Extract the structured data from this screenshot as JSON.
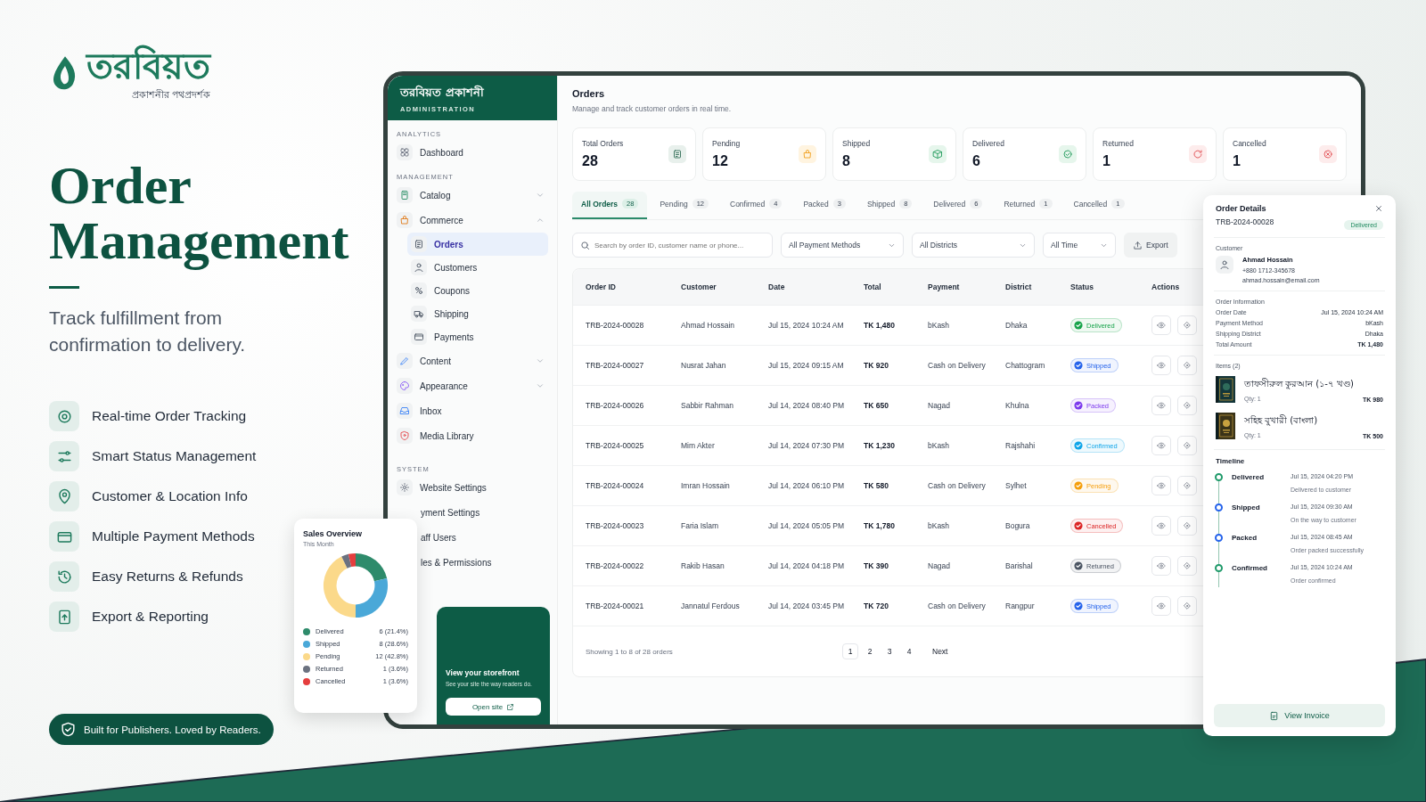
{
  "brand": {
    "name": "তরবিয়ত",
    "tagline": "প্রকাশনীর পথপ্রদর্শক"
  },
  "hero": {
    "title": "Order Management",
    "subtitle": "Track fulfillment from confirmation to delivery."
  },
  "features": [
    "Real-time Order Tracking",
    "Smart Status Management",
    "Customer & Location Info",
    "Multiple Payment Methods",
    "Easy Returns & Refunds",
    "Export & Reporting"
  ],
  "badge": "Built for Publishers. Loved by Readers.",
  "sidebar": {
    "title": "তরবিয়ত প্রকাশনী",
    "subtitle": "ADMINISTRATION",
    "sections": [
      {
        "label": "ANALYTICS",
        "items": [
          {
            "label": "Dashboard",
            "selected": false
          }
        ]
      },
      {
        "label": "MANAGEMENT",
        "items": [
          {
            "label": "Catalog",
            "selected": false,
            "expanded": false
          },
          {
            "label": "Commerce",
            "selected": false,
            "expanded": true,
            "children": [
              {
                "label": "Orders",
                "selected": true
              },
              {
                "label": "Customers",
                "selected": false
              },
              {
                "label": "Coupons",
                "selected": false
              },
              {
                "label": "Shipping",
                "selected": false
              },
              {
                "label": "Payments",
                "selected": false
              }
            ]
          },
          {
            "label": "Content",
            "selected": false,
            "expanded": false
          },
          {
            "label": "Appearance",
            "selected": false,
            "expanded": false
          },
          {
            "label": "Inbox",
            "selected": false
          },
          {
            "label": "Media Library",
            "selected": false
          }
        ]
      },
      {
        "label": "SYSTEM",
        "items": [
          {
            "label": "Website Settings",
            "selected": false
          },
          {
            "label": "yment Settings",
            "selected": false
          },
          {
            "label": "aff Users",
            "selected": false
          },
          {
            "label": "les & Permissions",
            "selected": false
          }
        ]
      }
    ]
  },
  "storefront": {
    "title": "View your storefront",
    "text": "See your site the way readers do.",
    "button": "Open site"
  },
  "sales_overview": {
    "title": "Sales Overview",
    "subtitle": "This Month",
    "chart_data": {
      "type": "donut",
      "categories": [
        "Delivered",
        "Shipped",
        "Pending",
        "Returned",
        "Cancelled"
      ],
      "values": [
        21.4,
        28.6,
        42.8,
        3.6,
        3.6
      ],
      "legend": "bottom"
    },
    "legend": [
      {
        "value": "6 (21.4%)",
        "color": "#2e8b6b"
      },
      {
        "value": "8 (28.6%)",
        "color": "#4aa8d8"
      },
      {
        "value": "12 (42.8%)",
        "color": "#fbd98a"
      },
      {
        "value": "1 (3.6%)",
        "color": "#6b7280"
      },
      {
        "value": "1 (3.6%)",
        "color": "#e53e3e"
      }
    ]
  },
  "page_header": {
    "title": "Orders",
    "subtitle": "Manage and track customer orders in real time."
  },
  "stats": [
    {
      "label": "Total Orders",
      "value": "28"
    },
    {
      "label": "Pending",
      "value": "12"
    },
    {
      "label": "Shipped",
      "value": "8"
    },
    {
      "label": "Delivered",
      "value": "6"
    },
    {
      "label": "Returned",
      "value": "1"
    },
    {
      "label": "Cancelled",
      "value": "1"
    }
  ],
  "tabs": [
    {
      "label": "All Orders",
      "count": "28",
      "selected": true
    },
    {
      "label": "Pending",
      "count": "12",
      "selected": false
    },
    {
      "label": "Confirmed",
      "count": "4",
      "selected": false
    },
    {
      "label": "Packed",
      "count": "3",
      "selected": false
    },
    {
      "label": "Shipped",
      "count": "8",
      "selected": false
    },
    {
      "label": "Delivered",
      "count": "6",
      "selected": false
    },
    {
      "label": "Returned",
      "count": "1",
      "selected": false
    },
    {
      "label": "Cancelled",
      "count": "1",
      "selected": false
    }
  ],
  "filters": {
    "search_placeholder": "Search by order ID, customer name or phone...",
    "dropdowns": [
      "All Payment Methods",
      "All Districts",
      "All Time"
    ],
    "export": "Export"
  },
  "table": {
    "columns": [
      "Order ID",
      "Customer",
      "Date",
      "Total",
      "Payment",
      "District",
      "Status",
      "Actions"
    ],
    "rows": [
      {
        "id": "TRB-2024-00028",
        "customer": "Ahmad Hossain",
        "date": "Jul 15, 2024 10:24 AM",
        "total": "TK 1,480",
        "payment": "bKash",
        "district": "Dhaka",
        "status": "Delivered",
        "color": "#16a34a"
      },
      {
        "id": "TRB-2024-00027",
        "customer": "Nusrat Jahan",
        "date": "Jul 15, 2024 09:15 AM",
        "total": "TK 920",
        "payment": "Cash on Delivery",
        "district": "Chattogram",
        "status": "Shipped",
        "color": "#2563eb"
      },
      {
        "id": "TRB-2024-00026",
        "customer": "Sabbir Rahman",
        "date": "Jul 14, 2024 08:40 PM",
        "total": "TK 650",
        "payment": "Nagad",
        "district": "Khulna",
        "status": "Packed",
        "color": "#7c3aed"
      },
      {
        "id": "TRB-2024-00025",
        "customer": "Mim Akter",
        "date": "Jul 14, 2024 07:30 PM",
        "total": "TK 1,230",
        "payment": "bKash",
        "district": "Rajshahi",
        "status": "Confirmed",
        "color": "#0ea5e9"
      },
      {
        "id": "TRB-2024-00024",
        "customer": "Imran Hossain",
        "date": "Jul 14, 2024 06:10 PM",
        "total": "TK 580",
        "payment": "Cash on Delivery",
        "district": "Sylhet",
        "status": "Pending",
        "color": "#f59e0b"
      },
      {
        "id": "TRB-2024-00023",
        "customer": "Faria Islam",
        "date": "Jul 14, 2024 05:05 PM",
        "total": "TK 1,780",
        "payment": "bKash",
        "district": "Bogura",
        "status": "Cancelled",
        "color": "#dc2626"
      },
      {
        "id": "TRB-2024-00022",
        "customer": "Rakib Hasan",
        "date": "Jul 14, 2024 04:18 PM",
        "total": "TK 390",
        "payment": "Nagad",
        "district": "Barishal",
        "status": "Returned",
        "color": "#4b5563"
      },
      {
        "id": "TRB-2024-00021",
        "customer": "Jannatul Ferdous",
        "date": "Jul 14, 2024 03:45 PM",
        "total": "TK 720",
        "payment": "Cash on Delivery",
        "district": "Rangpur",
        "status": "Shipped",
        "color": "#2563eb"
      }
    ]
  },
  "pagination": {
    "summary": "Showing 1 to 8 of 28 orders",
    "pages": [
      {
        "label": "1",
        "selected": true
      },
      {
        "label": "2",
        "selected": false
      },
      {
        "label": "3",
        "selected": false
      },
      {
        "label": "4",
        "selected": false
      }
    ],
    "next": "Next"
  },
  "order_details": {
    "title": "Order Details",
    "id": "TRB-2024-00028",
    "status": "Delivered",
    "customer": {
      "label": "Customer",
      "name": "Ahmad Hossain",
      "phone": "+880 1712-345678",
      "email": "ahmad.hossain@email.com"
    },
    "info": {
      "label": "Order Information",
      "rows": [
        {
          "label": "Order Date",
          "value": "Jul 15, 2024 10:24 AM"
        },
        {
          "label": "Payment Method",
          "value": "bKash"
        },
        {
          "label": "Shipping District",
          "value": "Dhaka"
        },
        {
          "label": "Total Amount",
          "value": "TK 1,480"
        }
      ]
    },
    "items": {
      "label": "Items (2)",
      "list": [
        {
          "title": "তাফসীরুল কুরআন (১-৭ খণ্ড)",
          "qty": "Qty: 1",
          "price": "TK 980"
        },
        {
          "title": "সহিহ বুখারী (বাংলা)",
          "qty": "Qty: 1",
          "price": "TK 500"
        }
      ]
    },
    "timeline": {
      "label": "Timeline",
      "events": [
        {
          "title": "Delivered",
          "time": "Jul 15, 2024 04:20 PM",
          "note": "Delivered to customer",
          "kind": "complete"
        },
        {
          "title": "Shipped",
          "time": "Jul 15, 2024 09:30 AM",
          "note": "On the way to customer",
          "kind": "transit"
        },
        {
          "title": "Packed",
          "time": "Jul 15, 2024 08:45 AM",
          "note": "Order packed successfully",
          "kind": "transit"
        },
        {
          "title": "Confirmed",
          "time": "Jul 15, 2024 10:24 AM",
          "note": "Order confirmed",
          "kind": "complete"
        }
      ]
    },
    "button": "View Invoice"
  }
}
